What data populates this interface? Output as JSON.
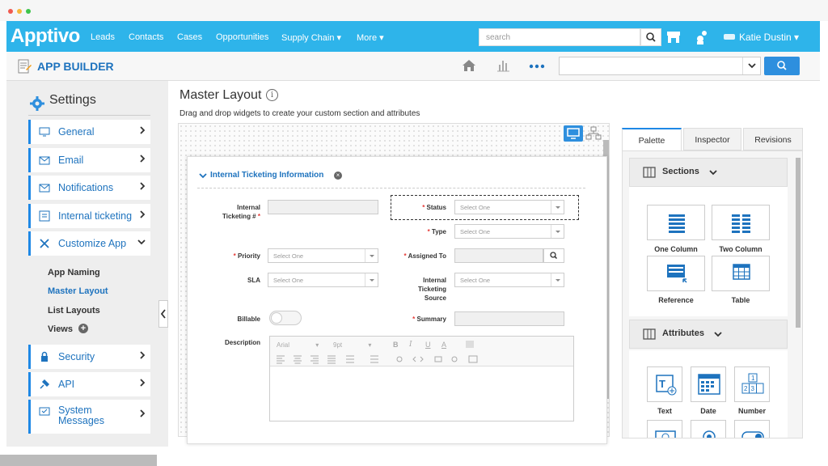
{
  "nav": {
    "logo": "Apptivo",
    "links": [
      "Leads",
      "Contacts",
      "Cases",
      "Opportunities",
      "Supply Chain",
      "More"
    ],
    "search_placeholder": "search",
    "user": "Katie Dustin"
  },
  "appbar": {
    "title": "APP BUILDER"
  },
  "sidebar": {
    "title": "Settings",
    "items": [
      {
        "label": "General"
      },
      {
        "label": "Email"
      },
      {
        "label": "Notifications"
      },
      {
        "label": "Internal ticketing"
      },
      {
        "label": "Customize App"
      }
    ],
    "sub_items": [
      "App Naming",
      "Master Layout",
      "List Layouts",
      "Views"
    ],
    "items_bottom": [
      {
        "label": "Security"
      },
      {
        "label": "API"
      },
      {
        "label": "System Messages"
      }
    ]
  },
  "main": {
    "title": "Master Layout",
    "subtitle": "Drag and drop widgets to create your custom section and attributes",
    "section_title": "Internal Ticketing Information",
    "fields": {
      "internal_ticketing_no": "Internal Ticketing #",
      "status": "Status",
      "type": "Type",
      "priority": "Priority",
      "assigned_to": "Assigned To",
      "sla": "SLA",
      "source": "Internal Ticketing Source",
      "billable": "Billable",
      "summary": "Summary",
      "description": "Description"
    },
    "select_placeholder": "Select One",
    "rte": {
      "font": "Arial",
      "size": "9pt"
    }
  },
  "panel": {
    "tabs": [
      "Palette",
      "Inspector",
      "Revisions"
    ],
    "sections_title": "Sections",
    "section_widgets": [
      "One Column",
      "Two Column",
      "Reference",
      "Table"
    ],
    "attributes_title": "Attributes",
    "attribute_widgets": [
      "Text",
      "Date",
      "Number"
    ]
  },
  "colors": {
    "brand": "#2eb4ea",
    "link": "#1e73be",
    "accent_border": "#1e88e5",
    "required": "#e53935"
  }
}
